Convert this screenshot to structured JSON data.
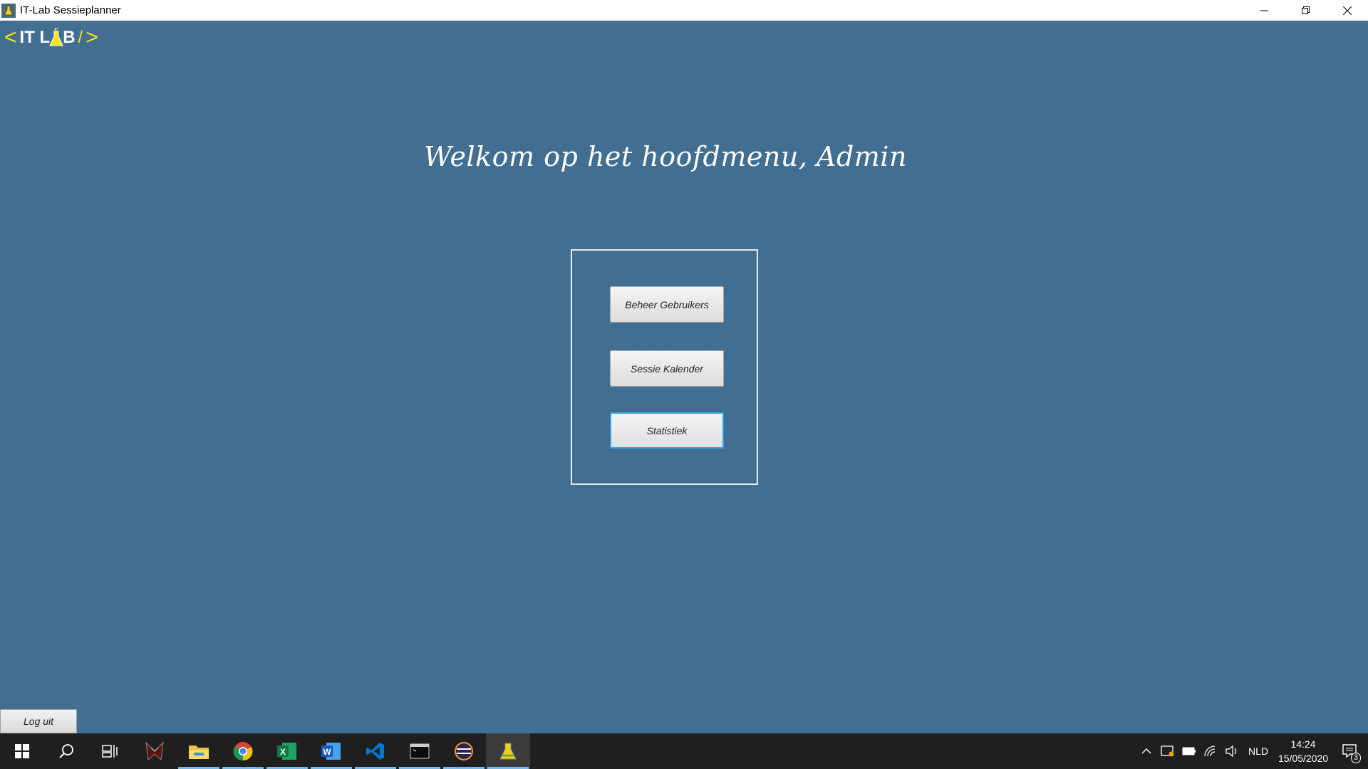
{
  "window": {
    "title": "IT-Lab Sessieplanner",
    "icon": "flask-app-icon",
    "controls": [
      "minimize",
      "restore",
      "close"
    ]
  },
  "logo": {
    "left_bracket": "<",
    "word": "IT L",
    "word_end": "B",
    "slash": "/",
    "right_bracket": ">",
    "colors": {
      "bracket": "#f4e61e",
      "text": "#ffffff"
    }
  },
  "main": {
    "welcome": "Welkom op het hoofdmenu, Admin",
    "buttons": [
      {
        "label": "Beheer Gebruikers"
      },
      {
        "label": "Sessie Kalender"
      },
      {
        "label": "Statistiek",
        "focused": true
      }
    ]
  },
  "footer": {
    "logout_label": "Log uit"
  },
  "taskbar": {
    "apps": [
      "windows-start-icon",
      "search-icon",
      "task-view-icon",
      "predator-icon",
      "file-explorer-icon",
      "chrome-icon",
      "excel-icon",
      "word-icon",
      "vscode-icon",
      "terminal-icon",
      "eclipse-icon",
      "itlab-flask-icon"
    ],
    "tray": {
      "language": "NLD",
      "time": "14:24",
      "date": "15/05/2020",
      "notification_count": "3"
    }
  },
  "colors": {
    "background": "#426f91",
    "taskbar": "#1f1f1f",
    "focus_ring": "#2fa4e4"
  }
}
